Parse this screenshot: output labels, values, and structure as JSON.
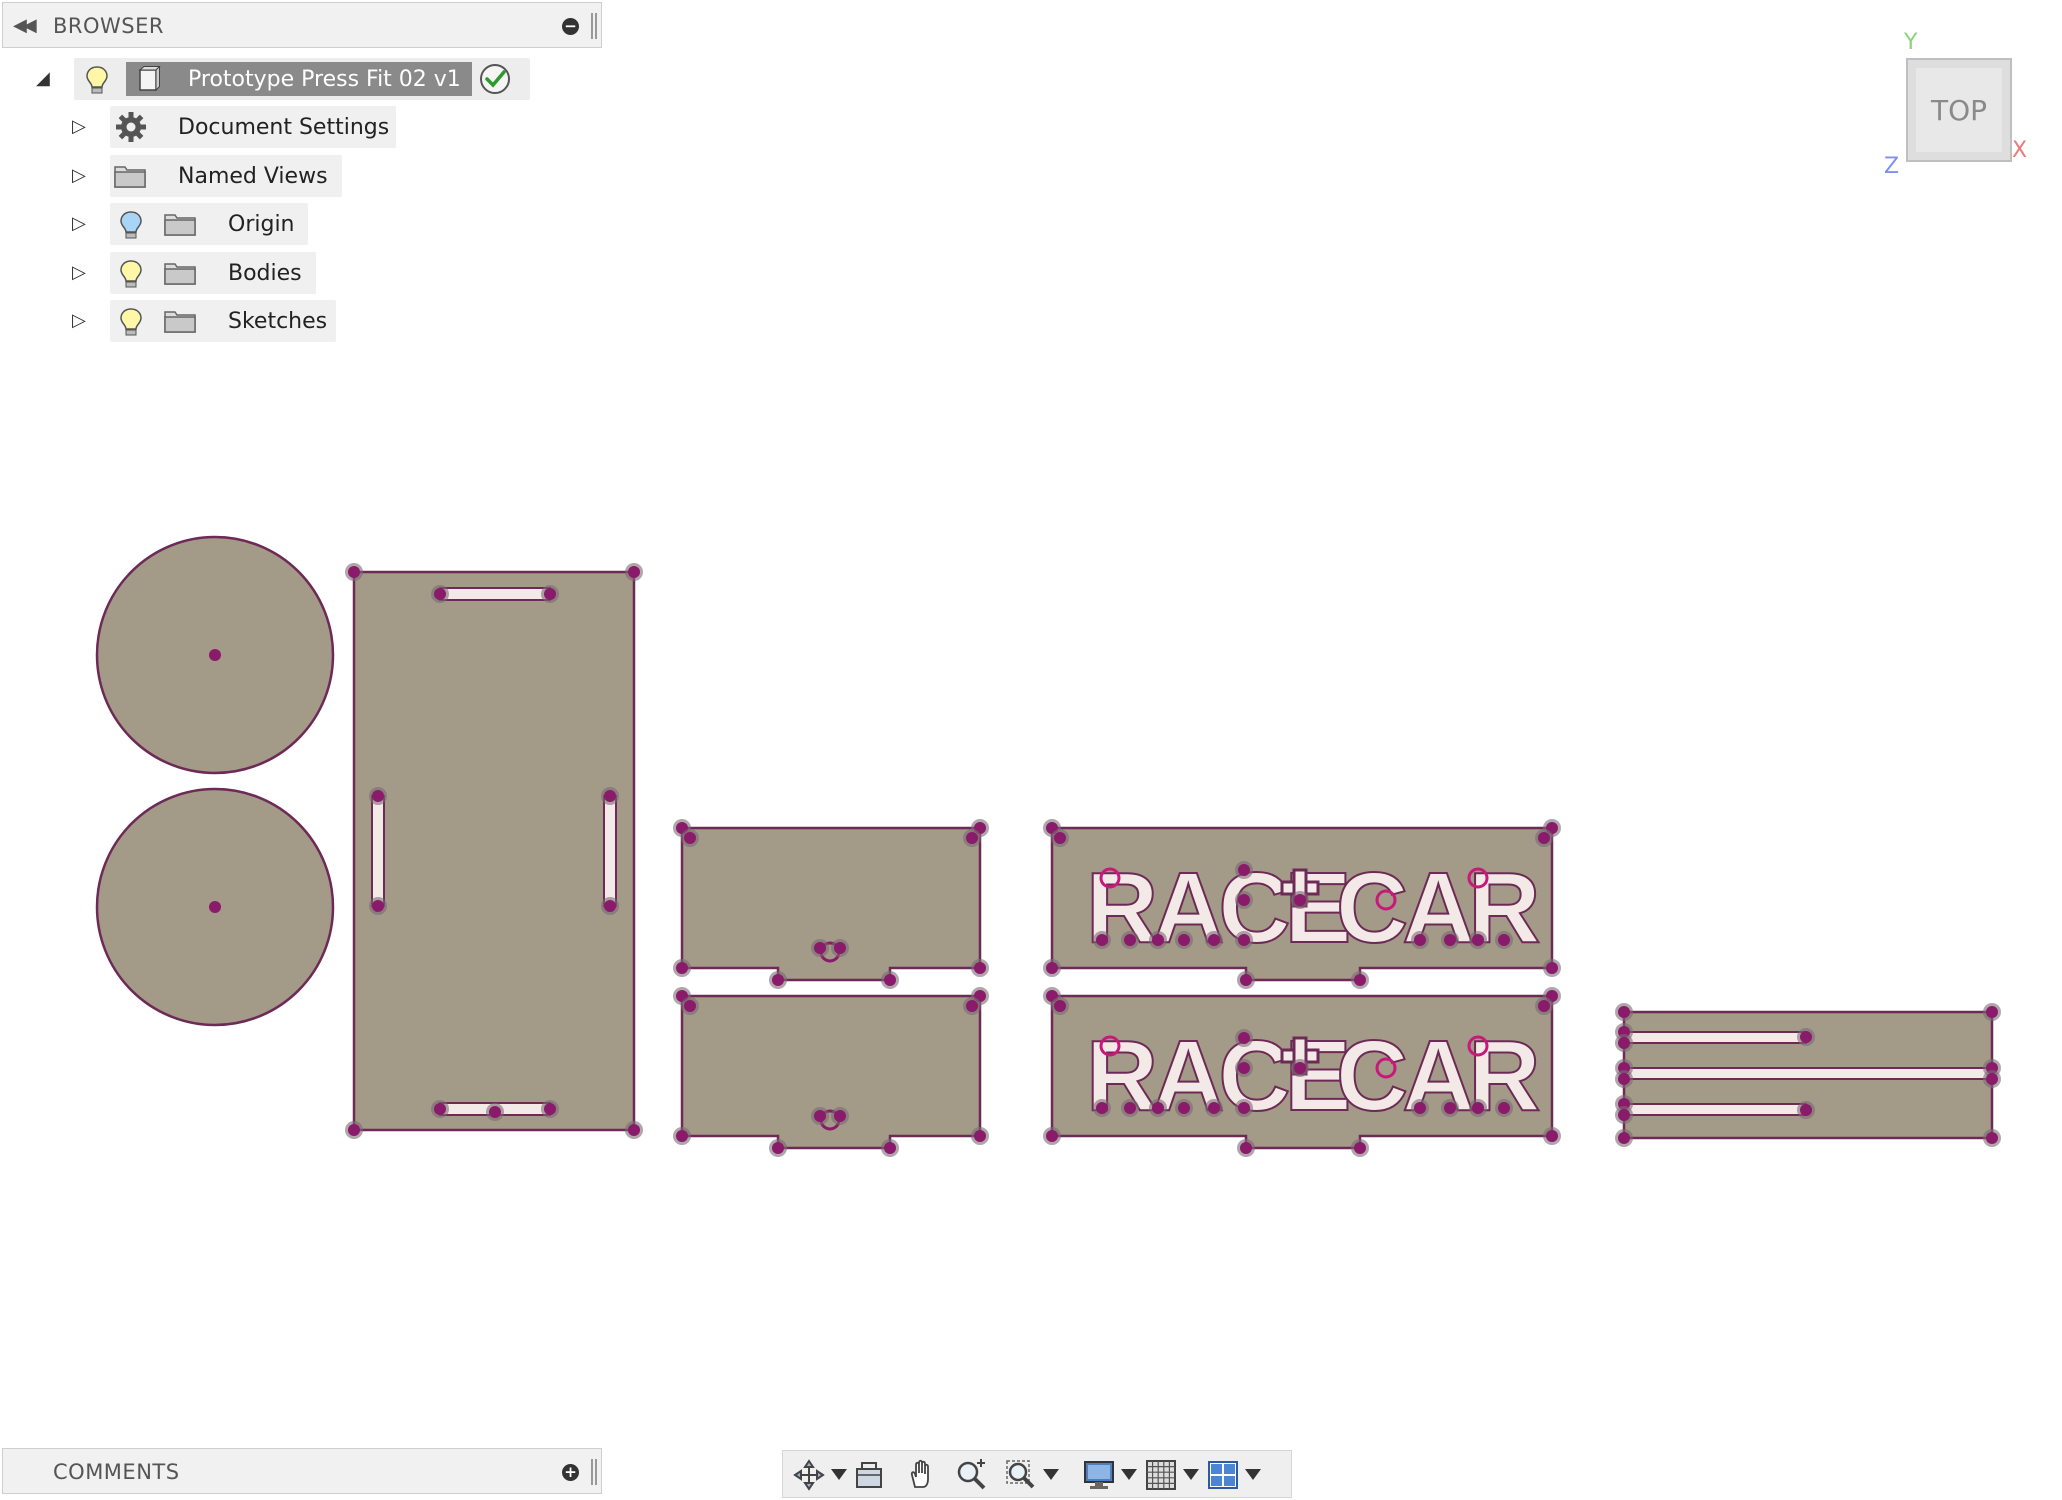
{
  "browser": {
    "title": "BROWSER",
    "collapse_glyph": "◀◀",
    "root": {
      "name": "Prototype Press Fit 02 v1",
      "expander": "◢"
    },
    "items": [
      {
        "label": "Document Settings",
        "expander": "▷",
        "icon": "gear-icon"
      },
      {
        "label": "Named Views",
        "expander": "▷",
        "icon": "folder-icon"
      },
      {
        "label": "Origin",
        "expander": "▷",
        "icon": "folder-icon",
        "bulb": "blue"
      },
      {
        "label": "Bodies",
        "expander": "▷",
        "icon": "folder-icon",
        "bulb": "yellow"
      },
      {
        "label": "Sketches",
        "expander": "▷",
        "icon": "folder-icon",
        "bulb": "yellow"
      }
    ],
    "minimize_glyph": "−"
  },
  "comments": {
    "title": "COMMENTS",
    "add_glyph": "+"
  },
  "viewcube": {
    "face": "TOP",
    "axis_x": "X",
    "axis_y": "Y",
    "axis_z": "Z"
  },
  "panel_text": {
    "race1": "RACE",
    "car1": "CAR",
    "race2": "RACE",
    "car2": "CAR"
  },
  "colors": {
    "part_fill": "#a39a87",
    "part_edge": "#6d2a56",
    "vertex": "#8a1a6a",
    "slot_fill": "#f3e9e6"
  },
  "toolbar": {
    "tools": [
      "orbit-icon",
      "look-at-icon",
      "pan-icon",
      "zoom-icon",
      "zoom-window-icon",
      "display-settings-icon",
      "grid-icon",
      "viewports-icon"
    ]
  }
}
